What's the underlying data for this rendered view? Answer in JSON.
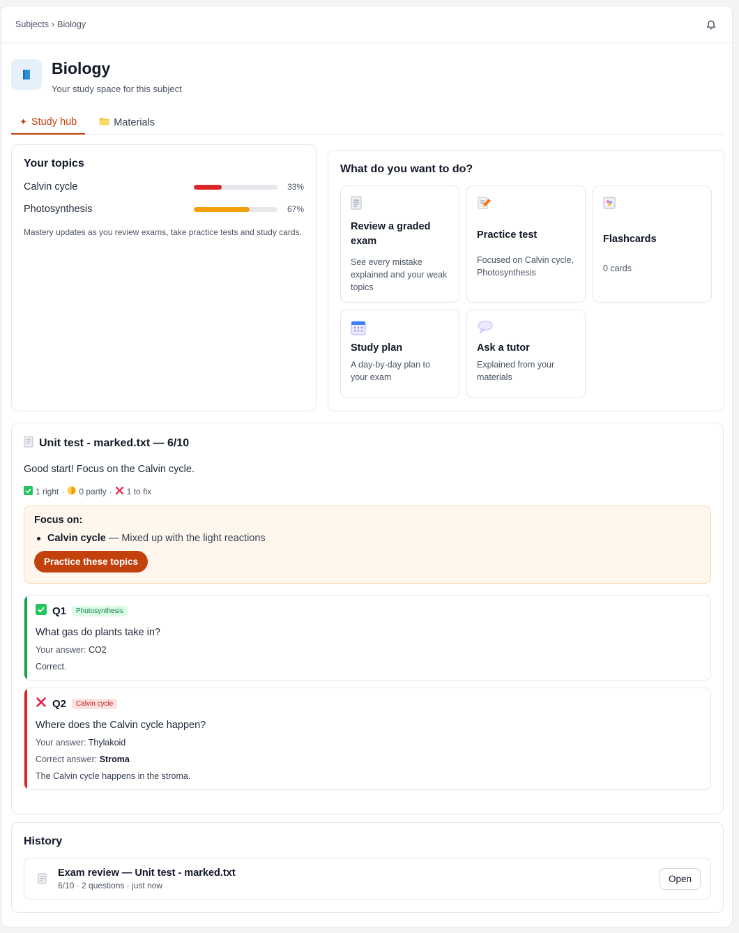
{
  "breadcrumb": {
    "root": "Subjects",
    "separator": "›",
    "current": "Biology"
  },
  "subject": {
    "title": "Biology",
    "subtitle": "Your study space for this subject"
  },
  "tabs": [
    {
      "label": "Study hub",
      "active": true,
      "icon": "sparkle-icon"
    },
    {
      "label": "Materials",
      "active": false,
      "icon": "folder-icon"
    }
  ],
  "topics": {
    "heading": "Your topics",
    "items": [
      {
        "name": "Calvin cycle",
        "percent_label": "33%",
        "mastery": 0.33,
        "color": "#dc2626"
      },
      {
        "name": "Photosynthesis",
        "percent_label": "67%",
        "mastery": 0.67,
        "color": "#f59e0b"
      }
    ],
    "note": "Mastery updates as you review exams, take practice tests and study cards."
  },
  "actions": {
    "heading": "What do you want to do?",
    "items": [
      {
        "title": "Review a graded exam",
        "desc": "See every mistake explained and your weak topics",
        "icon": "document-icon"
      },
      {
        "title": "Practice test",
        "desc": "Focused on Calvin cycle, Photosynthesis",
        "icon": "pencil-paper-icon"
      },
      {
        "title": "Flashcards",
        "desc": "0 cards",
        "icon": "card-index-icon"
      },
      {
        "title": "Study plan",
        "desc": "A day-by-day plan to your exam",
        "icon": "calendar-icon"
      },
      {
        "title": "Ask a tutor",
        "desc": "Explained from your materials",
        "icon": "speech-bubble-icon"
      }
    ]
  },
  "exam": {
    "title": "Unit test - marked.txt — 6/10",
    "summary": "Good start! Focus on the Calvin cycle.",
    "counts": {
      "right": "1 right",
      "partly": "0 partly",
      "fix": "1 to fix",
      "sep": "·"
    },
    "focus": {
      "heading": "Focus on:",
      "topic": "Calvin cycle",
      "detail": "— Mixed up with the light reactions",
      "button": "Practice these topics"
    },
    "questions": [
      {
        "num": "Q1",
        "tag": "Photosynthesis",
        "status": "correct",
        "text": "What gas do plants take in?",
        "your_answer_label": "Your answer:",
        "your_answer": "CO2",
        "explanation": "Correct."
      },
      {
        "num": "Q2",
        "tag": "Calvin cycle",
        "status": "wrong",
        "text": "Where does the Calvin cycle happen?",
        "your_answer_label": "Your answer:",
        "your_answer": "Thylakoid",
        "correct_label": "Correct answer:",
        "correct_answer": "Stroma",
        "explanation": "The Calvin cycle happens in the stroma."
      }
    ]
  },
  "history": {
    "heading": "History",
    "items": [
      {
        "title": "Exam review — Unit test - marked.txt",
        "meta": "6/10 · 2 questions · just now",
        "button": "Open"
      }
    ]
  },
  "colors": {
    "accent": "#c2410c",
    "correct": "#16a34a",
    "wrong": "#dc2626"
  }
}
